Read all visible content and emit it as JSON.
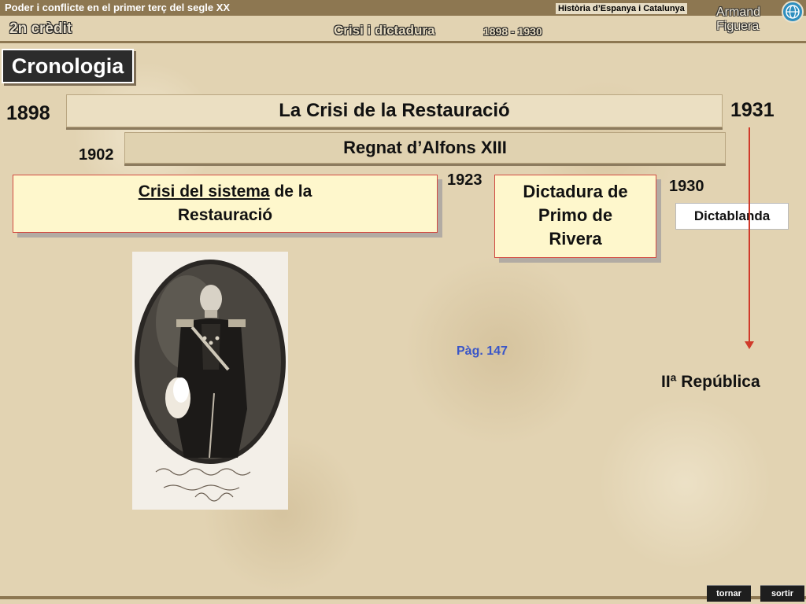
{
  "header": {
    "course_title": "Poder i conflicte en el primer terç del segle XX",
    "subject": "Història d’Espanya i Catalunya",
    "credit": "2n crèdit",
    "unit_title": "Crisi i dictadura",
    "unit_years": "1898 - 1930",
    "author_first": "Armand",
    "author_last": "Figuera"
  },
  "section_label": "Cronologia",
  "timeline": {
    "main_bar": {
      "start": "1898",
      "end": "1931",
      "label": "La Crisi de la Restauració"
    },
    "reign_bar": {
      "start": "1902",
      "label": "Regnat d’Alfons XIII"
    },
    "crisis_box": {
      "underlined": "Crisi del sistema",
      "rest": " de la",
      "line2": "Restauració"
    },
    "dictatorship_box": {
      "year": "1923",
      "line1": "Dictadura de",
      "line2": "Primo de",
      "line3": "Rivera"
    },
    "dictablanda": {
      "year": "1930",
      "label": "Dictablanda"
    },
    "republic_label": "IIª República"
  },
  "page_reference": "Pàg. 147",
  "colors": {
    "accent_bar": "#8d7751",
    "box_border": "#d24a40",
    "arrow": "#d03a2a",
    "link": "#3a56c8"
  },
  "footer": {
    "back_label": "tornar",
    "exit_label": "sortir"
  }
}
